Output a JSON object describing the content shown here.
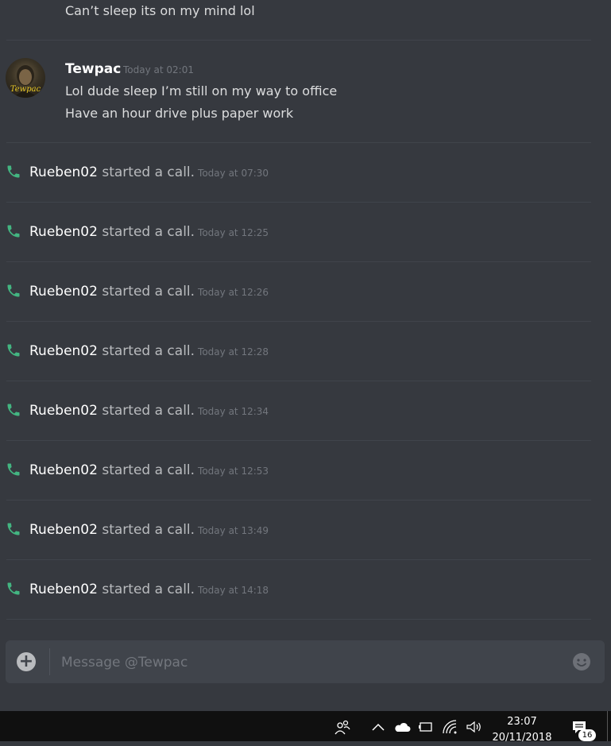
{
  "messages": {
    "prev_line": "Can’t sleep its on my mind lol",
    "group": {
      "username": "Tewpac",
      "timestamp": "Today at 02:01",
      "lines": [
        "Lol dude sleep I’m still on my way to office",
        "Have an hour drive plus paper work"
      ],
      "avatar_text": "Tewpac"
    }
  },
  "calls": [
    {
      "caller": "Rueben02",
      "action": "started a call.",
      "time": "Today at 07:30"
    },
    {
      "caller": "Rueben02",
      "action": "started a call.",
      "time": "Today at 12:25"
    },
    {
      "caller": "Rueben02",
      "action": "started a call.",
      "time": "Today at 12:26"
    },
    {
      "caller": "Rueben02",
      "action": "started a call.",
      "time": "Today at 12:28"
    },
    {
      "caller": "Rueben02",
      "action": "started a call.",
      "time": "Today at 12:34"
    },
    {
      "caller": "Rueben02",
      "action": "started a call.",
      "time": "Today at 12:53"
    },
    {
      "caller": "Rueben02",
      "action": "started a call.",
      "time": "Today at 13:49"
    },
    {
      "caller": "Rueben02",
      "action": "started a call.",
      "time": "Today at 14:18"
    }
  ],
  "composer": {
    "placeholder": "Message @Tewpac",
    "value": "",
    "attach_icon": "plus-circle-icon",
    "emoji_icon": "emoji-picker-icon"
  },
  "taskbar": {
    "time": "23:07",
    "date": "20/11/2018",
    "notification_count": "16",
    "icons": [
      "people-icon",
      "chevron-up-icon",
      "onedrive-cloud-icon",
      "battery-icon",
      "wifi-icon",
      "volume-icon",
      "action-center-icon"
    ]
  },
  "colors": {
    "background": "#36393f",
    "call_icon": "#43b581",
    "composer": "#40444b",
    "taskbar": "#101010"
  }
}
